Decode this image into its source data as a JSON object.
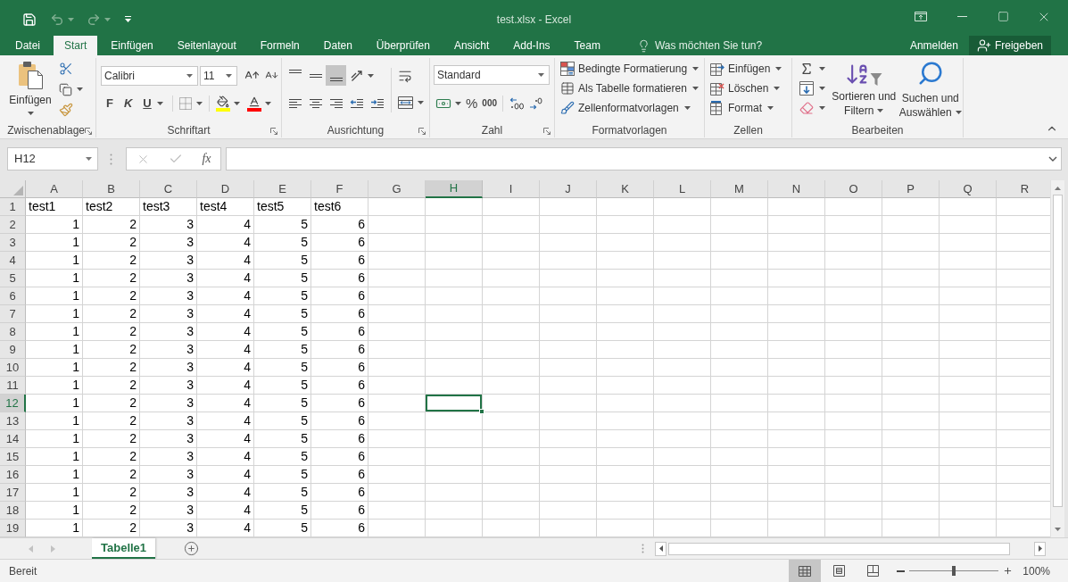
{
  "title_bar": {
    "title": "test.xlsx - Excel",
    "quick_access": [
      {
        "kind": "save",
        "disabled": false
      },
      {
        "kind": "undo",
        "disabled": true
      },
      {
        "kind": "redo",
        "disabled": true
      },
      {
        "kind": "customize",
        "disabled": false
      }
    ]
  },
  "tabs": [
    {
      "label": "Datei",
      "selected": false
    },
    {
      "label": "Start",
      "selected": true
    },
    {
      "label": "Einfügen",
      "selected": false
    },
    {
      "label": "Seitenlayout",
      "selected": false
    },
    {
      "label": "Formeln",
      "selected": false
    },
    {
      "label": "Daten",
      "selected": false
    },
    {
      "label": "Überprüfen",
      "selected": false
    },
    {
      "label": "Ansicht",
      "selected": false
    },
    {
      "label": "Add-Ins",
      "selected": false
    },
    {
      "label": "Team",
      "selected": false
    }
  ],
  "tell_me": {
    "placeholder": "Was möchten Sie tun?"
  },
  "account": {
    "sign_in": "Anmelden",
    "share": "Freigeben"
  },
  "ribbon": {
    "groups": [
      {
        "kind": "clipboard",
        "label": "Zwischenablage",
        "dialog_launcher": true,
        "paste": "Einfügen"
      },
      {
        "kind": "font",
        "label": "Schriftart",
        "dialog_launcher": true,
        "font_name": "Calibri",
        "font_size": "11",
        "styles": [
          {
            "kind": "bold",
            "label": "F"
          },
          {
            "kind": "italic",
            "label": "K"
          },
          {
            "kind": "underline",
            "label": "U"
          }
        ]
      },
      {
        "kind": "alignment",
        "label": "Ausrichtung",
        "dialog_launcher": true,
        "vertical_align": [
          {
            "kind": "top",
            "selected": false
          },
          {
            "kind": "middle",
            "selected": false
          },
          {
            "kind": "bottom",
            "selected": true
          }
        ]
      },
      {
        "kind": "number",
        "label": "Zahl",
        "dialog_launcher": true,
        "format": "Standard",
        "percent": "%",
        "thousands": "000"
      },
      {
        "kind": "styles",
        "label": "Formatvorlagen",
        "dialog_launcher": false,
        "items": [
          {
            "kind": "conditional",
            "label": "Bedingte Formatierung"
          },
          {
            "kind": "table",
            "label": "Als Tabelle formatieren"
          },
          {
            "kind": "cell_styles",
            "label": "Zellenformatvorlagen"
          }
        ]
      },
      {
        "kind": "cells",
        "label": "Zellen",
        "dialog_launcher": false,
        "items": [
          {
            "kind": "insert",
            "label": "Einfügen"
          },
          {
            "kind": "delete",
            "label": "Löschen"
          },
          {
            "kind": "format",
            "label": "Format"
          }
        ]
      },
      {
        "kind": "editing",
        "label": "Bearbeiten",
        "dialog_launcher": false,
        "sort": [
          "Sortieren und",
          "Filtern"
        ],
        "find": [
          "Suchen und",
          "Auswählen"
        ]
      }
    ]
  },
  "formula_bar": {
    "name_box": "H12",
    "cancel": {
      "disabled": true
    },
    "enter": {
      "disabled": true
    },
    "function_button": "fx"
  },
  "sheet": {
    "columns": [
      {
        "label": "A",
        "selected": false
      },
      {
        "label": "B",
        "selected": false
      },
      {
        "label": "C",
        "selected": false
      },
      {
        "label": "D",
        "selected": false
      },
      {
        "label": "E",
        "selected": false
      },
      {
        "label": "F",
        "selected": false
      },
      {
        "label": "G",
        "selected": false
      },
      {
        "label": "H",
        "selected": true
      },
      {
        "label": "I",
        "selected": false
      },
      {
        "label": "J",
        "selected": false
      },
      {
        "label": "K",
        "selected": false
      },
      {
        "label": "L",
        "selected": false
      },
      {
        "label": "M",
        "selected": false
      },
      {
        "label": "N",
        "selected": false
      },
      {
        "label": "O",
        "selected": false
      },
      {
        "label": "P",
        "selected": false
      },
      {
        "label": "Q",
        "selected": false
      },
      {
        "label": "R",
        "selected": false
      }
    ],
    "rows": [
      {
        "label": "1",
        "selected": false,
        "kind": "text",
        "cells": [
          "test1",
          "test2",
          "test3",
          "test4",
          "test5",
          "test6"
        ]
      },
      {
        "label": "2",
        "selected": false,
        "kind": "number",
        "cells": [
          "1",
          "2",
          "3",
          "4",
          "5",
          "6"
        ]
      },
      {
        "label": "3",
        "selected": false,
        "kind": "number",
        "cells": [
          "1",
          "2",
          "3",
          "4",
          "5",
          "6"
        ]
      },
      {
        "label": "4",
        "selected": false,
        "kind": "number",
        "cells": [
          "1",
          "2",
          "3",
          "4",
          "5",
          "6"
        ]
      },
      {
        "label": "5",
        "selected": false,
        "kind": "number",
        "cells": [
          "1",
          "2",
          "3",
          "4",
          "5",
          "6"
        ]
      },
      {
        "label": "6",
        "selected": false,
        "kind": "number",
        "cells": [
          "1",
          "2",
          "3",
          "4",
          "5",
          "6"
        ]
      },
      {
        "label": "7",
        "selected": false,
        "kind": "number",
        "cells": [
          "1",
          "2",
          "3",
          "4",
          "5",
          "6"
        ]
      },
      {
        "label": "8",
        "selected": false,
        "kind": "number",
        "cells": [
          "1",
          "2",
          "3",
          "4",
          "5",
          "6"
        ]
      },
      {
        "label": "9",
        "selected": false,
        "kind": "number",
        "cells": [
          "1",
          "2",
          "3",
          "4",
          "5",
          "6"
        ]
      },
      {
        "label": "10",
        "selected": false,
        "kind": "number",
        "cells": [
          "1",
          "2",
          "3",
          "4",
          "5",
          "6"
        ]
      },
      {
        "label": "11",
        "selected": false,
        "kind": "number",
        "cells": [
          "1",
          "2",
          "3",
          "4",
          "5",
          "6"
        ]
      },
      {
        "label": "12",
        "selected": true,
        "kind": "number",
        "cells": [
          "1",
          "2",
          "3",
          "4",
          "5",
          "6"
        ]
      },
      {
        "label": "13",
        "selected": false,
        "kind": "number",
        "cells": [
          "1",
          "2",
          "3",
          "4",
          "5",
          "6"
        ]
      },
      {
        "label": "14",
        "selected": false,
        "kind": "number",
        "cells": [
          "1",
          "2",
          "3",
          "4",
          "5",
          "6"
        ]
      },
      {
        "label": "15",
        "selected": false,
        "kind": "number",
        "cells": [
          "1",
          "2",
          "3",
          "4",
          "5",
          "6"
        ]
      },
      {
        "label": "16",
        "selected": false,
        "kind": "number",
        "cells": [
          "1",
          "2",
          "3",
          "4",
          "5",
          "6"
        ]
      },
      {
        "label": "17",
        "selected": false,
        "kind": "number",
        "cells": [
          "1",
          "2",
          "3",
          "4",
          "5",
          "6"
        ]
      },
      {
        "label": "18",
        "selected": false,
        "kind": "number",
        "cells": [
          "1",
          "2",
          "3",
          "4",
          "5",
          "6"
        ]
      },
      {
        "label": "19",
        "selected": false,
        "kind": "number",
        "cells": [
          "1",
          "2",
          "3",
          "4",
          "5",
          "6"
        ]
      }
    ]
  },
  "sheet_navigation": {
    "disabled": true
  },
  "sheet_tabs": [
    {
      "label": "Tabelle1",
      "selected": true
    }
  ],
  "status_bar": {
    "status": "Bereit",
    "views": [
      {
        "kind": "normal",
        "selected": true
      },
      {
        "kind": "page_layout",
        "selected": false
      },
      {
        "kind": "page_break",
        "selected": false
      }
    ],
    "zoom": {
      "level": 0.5,
      "reading": "100%"
    }
  }
}
